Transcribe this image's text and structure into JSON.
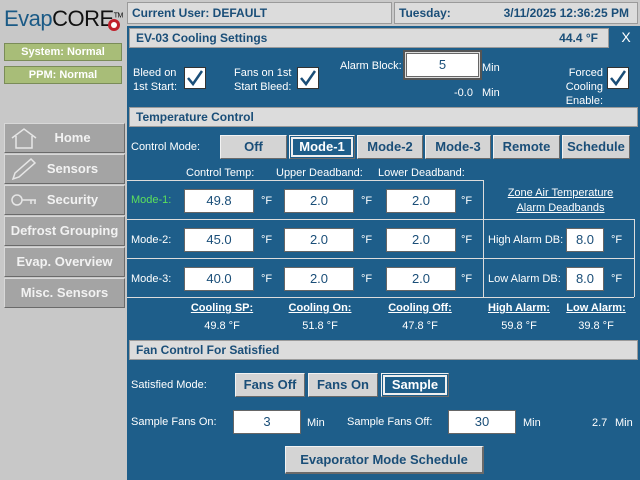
{
  "logo": {
    "evap": "Evap",
    "core": "CORE",
    "tm": "TM"
  },
  "status": {
    "system": "System: Normal",
    "ppm": "PPM: Normal"
  },
  "nav": {
    "home": "Home",
    "sensors": "Sensors",
    "security": "Security",
    "defrost": "Defrost Grouping",
    "evap_overview": "Evap. Overview",
    "misc_sensors": "Misc. Sensors"
  },
  "header": {
    "user": "Current User: DEFAULT",
    "day": "Tuesday:",
    "datetime": "3/11/2025 12:36:25 PM"
  },
  "panel": {
    "title": "EV-03 Cooling Settings",
    "temp": "44.4 °F",
    "close": "X"
  },
  "top_settings": {
    "bleed_label1": "Bleed on",
    "bleed_label2": "1st Start:",
    "fans_label1": "Fans on 1st",
    "fans_label2": "Start Bleed:",
    "alarm_block_label": "Alarm Block:",
    "alarm_block_value": "5",
    "alarm_block_unit": "Min",
    "alarm_block_current": "-0.0",
    "alarm_block_current_unit": "Min",
    "forced_label1": "Forced Cooling",
    "forced_label2": "Enable:"
  },
  "temperature_control": {
    "title": "Temperature Control",
    "control_mode_label": "Control Mode:",
    "modes": [
      "Off",
      "Mode-1",
      "Mode-2",
      "Mode-3",
      "Remote",
      "Schedule"
    ],
    "active_mode": "Mode-1",
    "col_headers": {
      "control_temp": "Control Temp:",
      "upper_db": "Upper Deadband:",
      "lower_db": "Lower Deadband:"
    },
    "rows": [
      {
        "label": "Mode-1:",
        "control": "49.8",
        "upper": "2.0",
        "lower": "2.0"
      },
      {
        "label": "Mode-2:",
        "control": "45.0",
        "upper": "2.0",
        "lower": "2.0"
      },
      {
        "label": "Mode-3:",
        "control": "40.0",
        "upper": "2.0",
        "lower": "2.0"
      }
    ],
    "unit_f": "°F",
    "zone_title1": "Zone Air Temperature",
    "zone_title2": "Alarm Deadbands",
    "high_alarm_db_label": "High Alarm DB:",
    "high_alarm_db": "8.0",
    "low_alarm_db_label": "Low Alarm DB:",
    "low_alarm_db": "8.0",
    "summary": [
      {
        "label": "Cooling SP:",
        "value": "49.8 °F"
      },
      {
        "label": "Cooling On:",
        "value": "51.8 °F"
      },
      {
        "label": "Cooling Off:",
        "value": "47.8 °F"
      },
      {
        "label": "High Alarm:",
        "value": "59.8 °F"
      },
      {
        "label": "Low Alarm:",
        "value": "39.8 °F"
      }
    ]
  },
  "fan_control": {
    "title": "Fan Control For Satisfied",
    "satisfied_mode_label": "Satisfied Mode:",
    "modes": [
      "Fans Off",
      "Fans On",
      "Sample"
    ],
    "active_mode": "Sample",
    "sample_on_label": "Sample Fans On:",
    "sample_on": "3",
    "sample_on_unit": "Min",
    "sample_off_label": "Sample Fans Off:",
    "sample_off": "30",
    "sample_off_unit": "Min",
    "current": "2.7",
    "current_unit": "Min"
  },
  "schedule_button": "Evaporator Mode Schedule",
  "colors": {
    "panel_bg": "#1e5e8a",
    "header_text": "#1a4e78",
    "status_green": "#a8bd78",
    "mode1_label": "#5ce05c"
  }
}
